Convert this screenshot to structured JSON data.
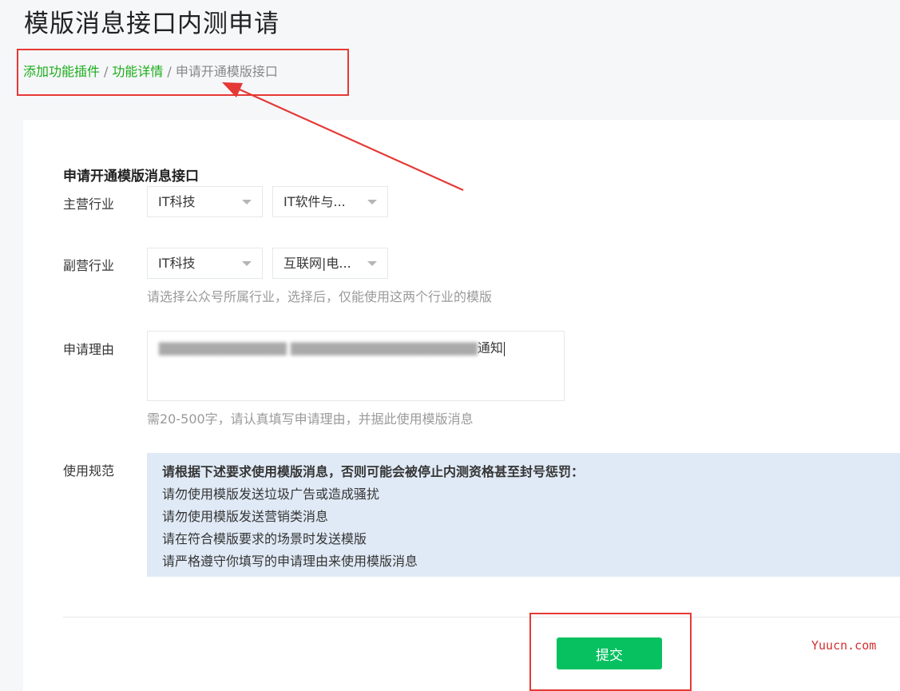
{
  "page": {
    "title": "模版消息接口内测申请"
  },
  "breadcrumb": {
    "items": [
      {
        "label": "添加功能插件",
        "link": true
      },
      {
        "label": "功能详情",
        "link": true
      },
      {
        "label": "申请开通模版接口",
        "link": false
      }
    ],
    "separator": "/"
  },
  "form": {
    "heading": "申请开通模版消息接口",
    "primary_industry": {
      "label": "主营行业",
      "select1": "IT科技",
      "select2": "IT软件与..."
    },
    "secondary_industry": {
      "label": "副营行业",
      "select1": "IT科技",
      "select2": "互联网|电...",
      "hint": "请选择公众号所属行业，选择后，仅能使用这两个行业的模版"
    },
    "reason": {
      "label": "申请理由",
      "value_visible_end": "通知",
      "hint": "需20-500字，请认真填写申请理由，并据此使用模版消息"
    },
    "usage_rules": {
      "label": "使用规范",
      "heading": "请根据下述要求使用模版消息，否则可能会被停止内测资格甚至封号惩罚：",
      "items": [
        "请勿使用模版发送垃圾广告或造成骚扰",
        "请勿使用模版发送营销类消息",
        "请在符合模版要求的场景时发送模版",
        "请严格遵守你填写的申请理由来使用模版消息"
      ]
    },
    "submit_label": "提交"
  },
  "watermark": "Yuucn.com",
  "colors": {
    "accent_green": "#07c160",
    "link_green": "#1aad19",
    "annotation_red": "#e53935",
    "notice_bg": "#e0eaf6"
  }
}
